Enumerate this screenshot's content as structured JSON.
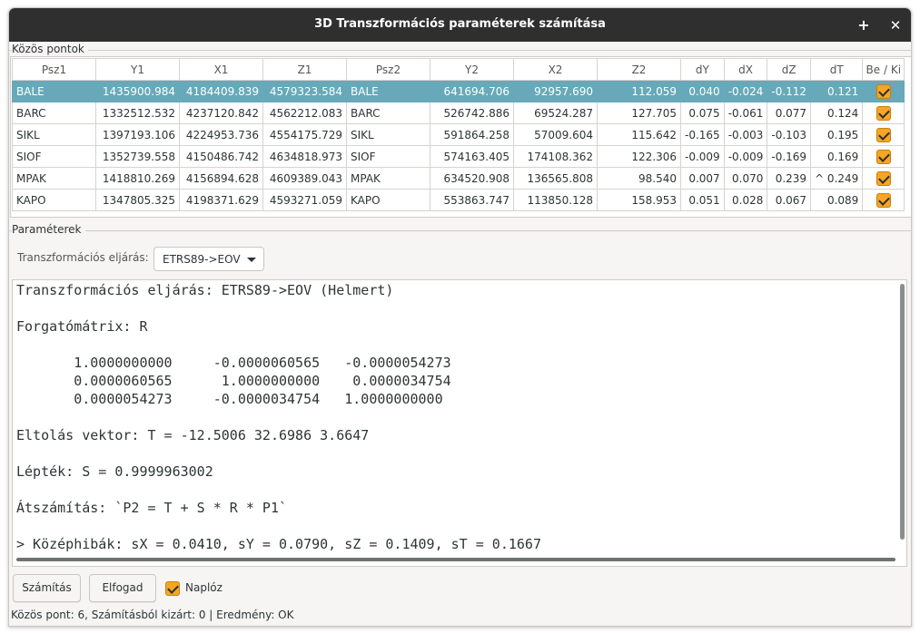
{
  "window": {
    "title": "3D Transzformációs paraméterek számítása",
    "plus_glyph": "+",
    "close_glyph": "✕"
  },
  "common_points": {
    "group_label": "Közös pontok",
    "columns": [
      "Psz1",
      "Y1",
      "X1",
      "Z1",
      "Psz2",
      "Y2",
      "X2",
      "Z2",
      "dY",
      "dX",
      "dZ",
      "dT",
      "Be / Ki"
    ],
    "rows": [
      {
        "psz1": "BALE",
        "y1": "1435900.984",
        "x1": "4184409.839",
        "z1": "4579323.584",
        "psz2": "BALE",
        "y2": "641694.706",
        "x2": "92957.690",
        "z2": "112.059",
        "dy": "0.040",
        "dx": "-0.024",
        "dz": "-0.112",
        "dt": "0.121",
        "enabled": true,
        "selected": true
      },
      {
        "psz1": "BARC",
        "y1": "1332512.532",
        "x1": "4237120.842",
        "z1": "4562212.083",
        "psz2": "BARC",
        "y2": "526742.886",
        "x2": "69524.287",
        "z2": "127.705",
        "dy": "0.075",
        "dx": "-0.061",
        "dz": "0.077",
        "dt": "0.124",
        "enabled": true,
        "selected": false
      },
      {
        "psz1": "SIKL",
        "y1": "1397193.106",
        "x1": "4224953.736",
        "z1": "4554175.729",
        "psz2": "SIKL",
        "y2": "591864.258",
        "x2": "57009.604",
        "z2": "115.642",
        "dy": "-0.165",
        "dx": "-0.003",
        "dz": "-0.103",
        "dt": "0.195",
        "enabled": true,
        "selected": false
      },
      {
        "psz1": "SIOF",
        "y1": "1352739.558",
        "x1": "4150486.742",
        "z1": "4634818.973",
        "psz2": "SIOF",
        "y2": "574163.405",
        "x2": "174108.362",
        "z2": "122.306",
        "dy": "-0.009",
        "dx": "-0.009",
        "dz": "-0.169",
        "dt": "0.169",
        "enabled": true,
        "selected": false
      },
      {
        "psz1": "MPAK",
        "y1": "1418810.269",
        "x1": "4156894.628",
        "z1": "4609389.043",
        "psz2": "MPAK",
        "y2": "634520.908",
        "x2": "136565.808",
        "z2": "98.540",
        "dy": "0.007",
        "dx": "0.070",
        "dz": "0.239",
        "dt": "^ 0.249",
        "enabled": true,
        "selected": false
      },
      {
        "psz1": "KAPO",
        "y1": "1347805.325",
        "x1": "4198371.629",
        "z1": "4593271.059",
        "psz2": "KAPO",
        "y2": "553863.747",
        "x2": "113850.128",
        "z2": "158.953",
        "dy": "0.051",
        "dx": "0.028",
        "dz": "0.067",
        "dt": "0.089",
        "enabled": true,
        "selected": false
      }
    ]
  },
  "parameters": {
    "group_label": "Paraméterek",
    "method_label": "Transzformációs eljárás:",
    "method_value": "ETRS89->EOV",
    "output_lines": [
      "Transzformációs eljárás: ETRS89->EOV (Helmert)",
      "",
      "Forgatómátrix: R",
      "",
      "       1.0000000000     -0.0000060565   -0.0000054273",
      "       0.0000060565      1.0000000000    0.0000034754",
      "       0.0000054273     -0.0000034754   1.0000000000",
      "",
      "Eltolás vektor: T = -12.5006 32.6986 3.6647",
      "",
      "Lépték: S = 0.9999963002",
      "",
      "Átszámítás: `P2 = T + S * R * P1`",
      "",
      "> Középhibák: sX = 0.0410, sY = 0.0790, sZ = 0.1409, sT = 0.1667"
    ]
  },
  "actions": {
    "compute_label": "Számítás",
    "accept_label": "Elfogad",
    "log_label": "Naplóz",
    "log_checked": true
  },
  "status": {
    "text": "Közös pont: 6, Számításból kizárt: 0  |  Eredmény: OK"
  },
  "colors": {
    "selected_row": "#67a9b8",
    "checkbox": "#f5a623",
    "titlebar": "#2f2f2f"
  }
}
